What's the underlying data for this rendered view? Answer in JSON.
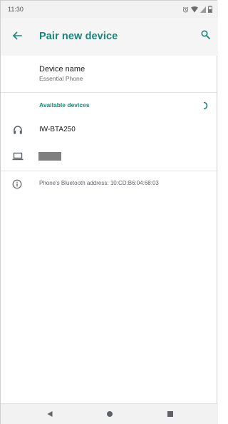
{
  "status_bar": {
    "time": "11:30",
    "icons": [
      "alarm-icon",
      "wifi-icon",
      "signal-icon",
      "battery-icon"
    ]
  },
  "app_bar": {
    "title": "Pair new device",
    "back_icon": "arrow-left-icon",
    "search_icon": "search-icon"
  },
  "device_name": {
    "title": "Device name",
    "value": "Essential Phone"
  },
  "available_devices": {
    "header": "Available devices",
    "items": [
      {
        "label": "IW-BTA250",
        "icon": "headphones-icon"
      },
      {
        "label": "",
        "icon": "laptop-icon",
        "redacted": true
      }
    ]
  },
  "info": {
    "text": "Phone's Bluetooth address: 10:CD:B6:04:68:03",
    "icon": "info-icon"
  },
  "nav_bar": {
    "buttons": [
      "back-triangle-icon",
      "home-circle-icon",
      "recents-square-icon"
    ]
  },
  "colors": {
    "accent": "#1a8577",
    "app_bar_bg": "#f5f5f5",
    "status_bar_bg": "#f2f2f2",
    "redaction": "#7f7f7f"
  }
}
